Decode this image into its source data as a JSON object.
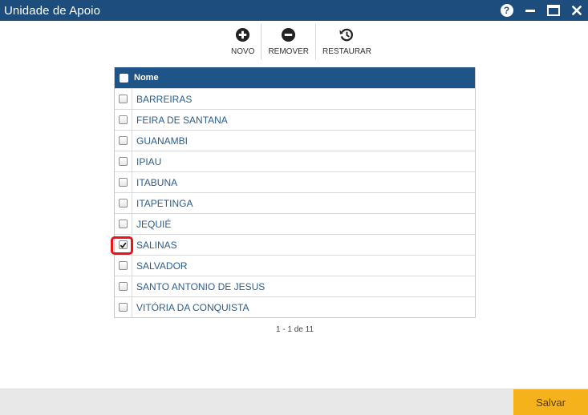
{
  "window": {
    "title": "Unidade de Apoio",
    "help_label": "?"
  },
  "toolbar": {
    "novo_label": "NOVO",
    "remover_label": "REMOVER",
    "restaurar_label": "RESTAURAR"
  },
  "grid": {
    "header": "Nome",
    "header_checked": false,
    "rows": [
      {
        "name": "BARREIRAS",
        "checked": false
      },
      {
        "name": "FEIRA DE SANTANA",
        "checked": false
      },
      {
        "name": "GUANAMBI",
        "checked": false
      },
      {
        "name": "IPIAU",
        "checked": false
      },
      {
        "name": "ITABUNA",
        "checked": false
      },
      {
        "name": "ITAPETINGA",
        "checked": false
      },
      {
        "name": "JEQUIÉ",
        "checked": false
      },
      {
        "name": "SALINAS",
        "checked": true
      },
      {
        "name": "SALVADOR",
        "checked": false
      },
      {
        "name": "SANTO ANTONIO DE JESUS",
        "checked": false
      },
      {
        "name": "VITÓRIA DA CONQUISTA",
        "checked": false
      }
    ]
  },
  "pager": {
    "text": "1 - 1 de 11"
  },
  "footer": {
    "save_label": "Salvar"
  },
  "colors": {
    "titlebar": "#1d4d7c",
    "grid_header": "#1f5488",
    "row_text": "#2b5d8b",
    "save_button": "#f6b21b",
    "highlight": "#e8141a"
  },
  "icons": {
    "help": "help-icon",
    "minimize": "minimize-icon",
    "maximize": "maximize-icon",
    "close": "close-icon",
    "novo": "plus-circle-icon",
    "remover": "minus-circle-icon",
    "restaurar": "restore-history-icon"
  }
}
